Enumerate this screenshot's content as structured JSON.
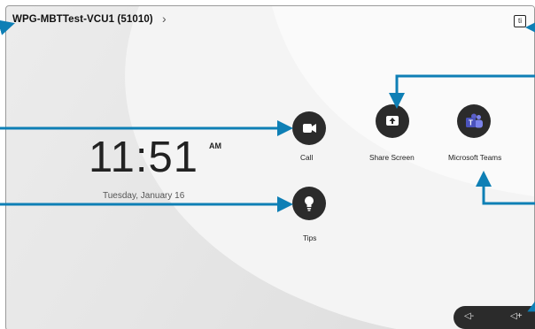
{
  "device": {
    "name": "WPG-MBTTest-VCU1 (51010)",
    "chevron": "›",
    "top_right_icon": "ti"
  },
  "clock": {
    "time": "11:51",
    "period": "AM",
    "date": "Tuesday, January 16"
  },
  "apps": [
    {
      "label": "Call",
      "icon": "video-camera-icon"
    },
    {
      "label": "Share Screen",
      "icon": "share-screen-icon"
    },
    {
      "label": "Microsoft Teams",
      "icon": "microsoft-teams-icon"
    },
    {
      "label": "Tips",
      "icon": "lightbulb-icon"
    }
  ],
  "volume": {
    "down": "◁-",
    "up": "◁+"
  },
  "colors": {
    "annotation": "#0e7fb5",
    "tile": "#2b2b2b",
    "teams": "#5b5fc7"
  }
}
